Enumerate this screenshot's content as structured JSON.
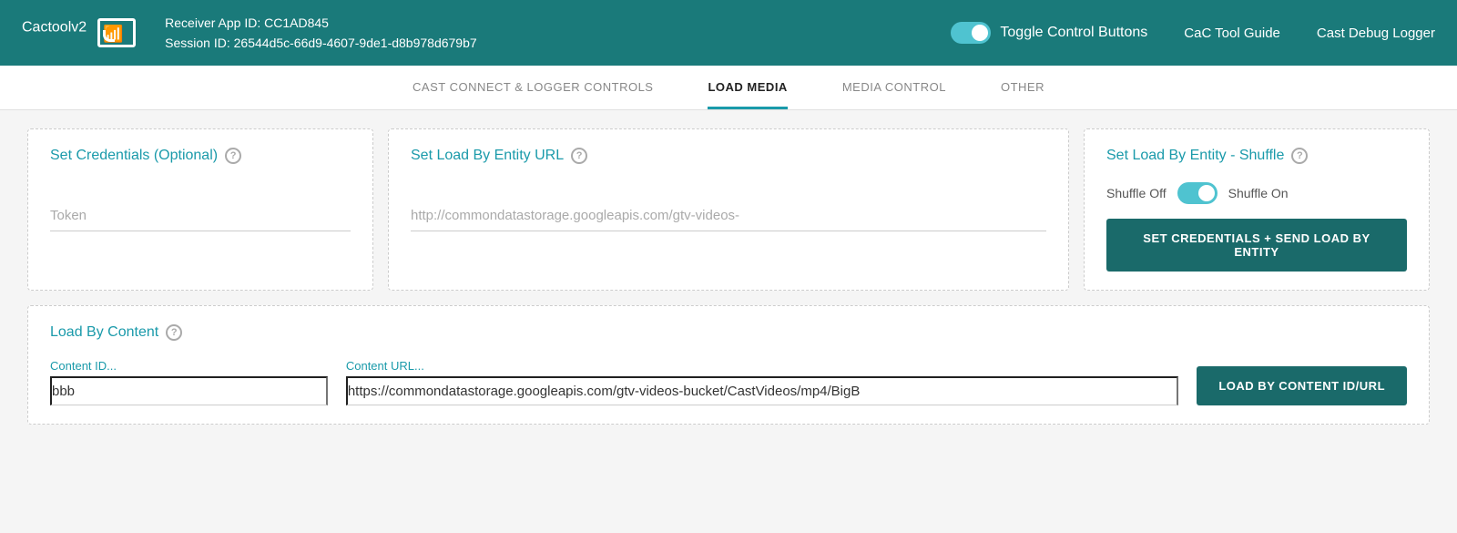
{
  "header": {
    "logo_text": "Cactool",
    "logo_version": "v2",
    "receiver_label": "Receiver App ID:",
    "receiver_id": "CC1AD845",
    "session_label": "Session ID:",
    "session_id": "26544d5c-66d9-4607-9de1-d8b978d679b7",
    "toggle_label": "Toggle Control Buttons",
    "link_guide": "CaC Tool Guide",
    "link_logger": "Cast Debug Logger"
  },
  "tabs": [
    {
      "id": "cast-connect",
      "label": "CAST CONNECT & LOGGER CONTROLS",
      "active": false
    },
    {
      "id": "load-media",
      "label": "LOAD MEDIA",
      "active": true
    },
    {
      "id": "media-control",
      "label": "MEDIA CONTROL",
      "active": false
    },
    {
      "id": "other",
      "label": "OTHER",
      "active": false
    }
  ],
  "cards": {
    "credentials": {
      "title": "Set Credentials (Optional)",
      "help": "?",
      "token_placeholder": "Token",
      "token_value": ""
    },
    "entity_url": {
      "title": "Set Load By Entity URL",
      "help": "?",
      "url_placeholder": "http://commondatastorage.googleapis.com/gtv-videos-",
      "url_value": ""
    },
    "shuffle": {
      "title": "Set Load By Entity - Shuffle",
      "help": "?",
      "shuffle_off_label": "Shuffle Off",
      "shuffle_on_label": "Shuffle On",
      "button_label": "SET CREDENTIALS + SEND LOAD BY ENTITY"
    },
    "load_content": {
      "title": "Load By Content",
      "help": "?",
      "content_id_label": "Content ID...",
      "content_id_value": "bbb",
      "content_url_label": "Content URL...",
      "content_url_value": "https://commondatastorage.googleapis.com/gtv-videos-bucket/CastVideos/mp4/BigB",
      "button_label": "LOAD BY CONTENT ID/URL"
    }
  }
}
